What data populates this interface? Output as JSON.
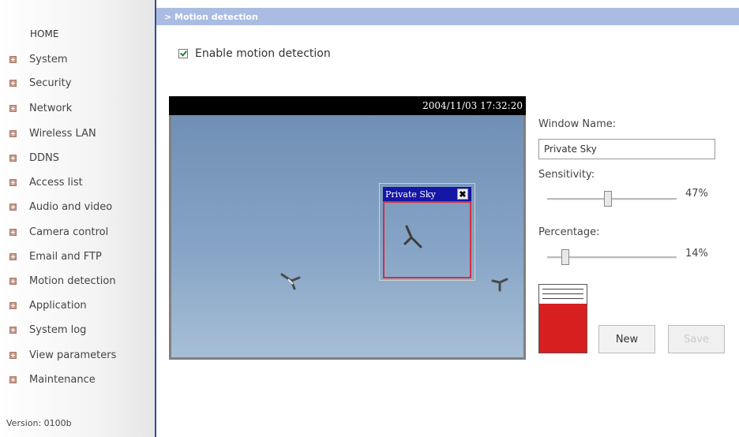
{
  "sidebar": {
    "home_label": "HOME",
    "items": [
      {
        "label": "System"
      },
      {
        "label": "Security"
      },
      {
        "label": "Network"
      },
      {
        "label": "Wireless LAN"
      },
      {
        "label": "DDNS"
      },
      {
        "label": "Access list"
      },
      {
        "label": "Audio and video"
      },
      {
        "label": "Camera control"
      },
      {
        "label": "Email and FTP"
      },
      {
        "label": "Motion detection"
      },
      {
        "label": "Application"
      },
      {
        "label": "System log"
      },
      {
        "label": "View parameters"
      },
      {
        "label": "Maintenance"
      }
    ],
    "version_text": "Version: 0100b"
  },
  "header": {
    "title": "> Motion detection"
  },
  "enable": {
    "label": "Enable motion detection",
    "checked": true
  },
  "camera": {
    "timestamp": "2004/11/03 17:32:20"
  },
  "motion_window": {
    "title": "Private Sky",
    "close_glyph": "✖"
  },
  "panel": {
    "window_name_label": "Window Name:",
    "window_name_value": "Private Sky",
    "sensitivity_label": "Sensitivity:",
    "sensitivity_value": "47%",
    "sensitivity_fraction": 0.47,
    "percentage_label": "Percentage:",
    "percentage_value": "14%",
    "percentage_fraction": 0.14,
    "level_fraction": 0.72
  },
  "buttons": {
    "new_label": "New",
    "save_label": "Save"
  },
  "colors": {
    "accent_header": "#aabce2",
    "sidebar_divider": "#2c4f9a",
    "motion_title_bg": "#1515a6",
    "motion_border": "#d03040",
    "level_red": "#d81f1f"
  }
}
